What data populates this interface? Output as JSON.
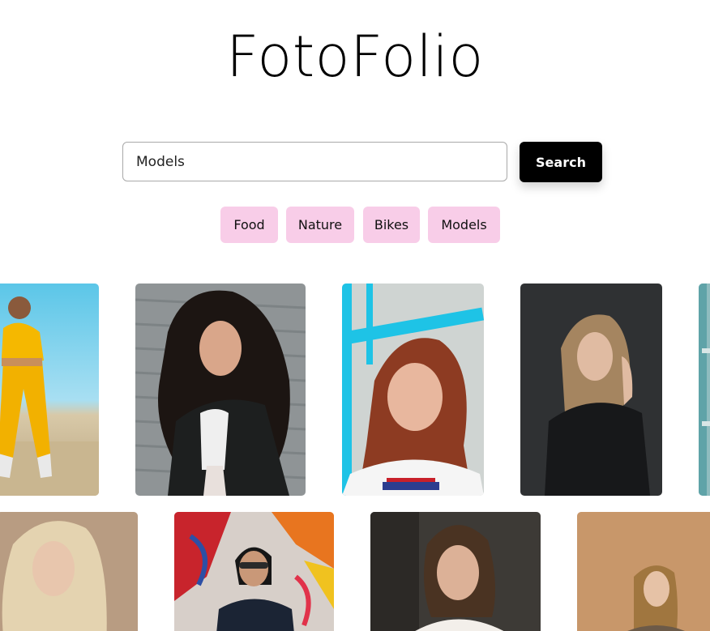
{
  "header": {
    "title": "FotoFolio"
  },
  "search": {
    "value": "Models",
    "button_label": "Search"
  },
  "categories": [
    "Food",
    "Nature",
    "Bikes",
    "Models"
  ],
  "colors": {
    "chip_bg": "#f8cde8",
    "button_bg": "#000000"
  },
  "gallery": {
    "row1": [
      {
        "name": "photo-model-yellow-tracksuit"
      },
      {
        "name": "photo-model-curly-hair"
      },
      {
        "name": "photo-model-red-hair"
      },
      {
        "name": "photo-model-dark-studio"
      },
      {
        "name": "photo-model-partial-edge"
      }
    ],
    "row2": [
      {
        "name": "photo-model-blonde"
      },
      {
        "name": "photo-model-sunglasses-graffiti"
      },
      {
        "name": "photo-model-white-sweater"
      },
      {
        "name": "photo-model-warm-backdrop"
      }
    ]
  }
}
